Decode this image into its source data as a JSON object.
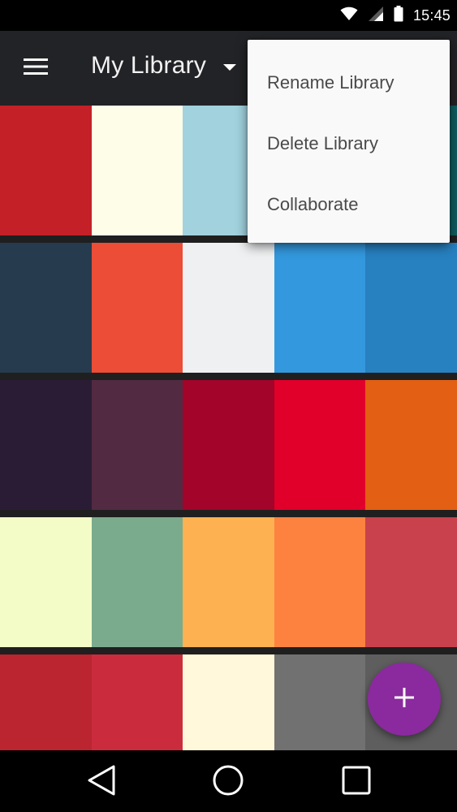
{
  "status_bar": {
    "time": "15:45",
    "icons": [
      "wifi-icon",
      "signal-icon",
      "battery-icon"
    ]
  },
  "app_bar": {
    "menu_icon": "hamburger-menu-icon",
    "title": "My Library",
    "dropdown_icon": "caret-down-icon"
  },
  "overflow_menu": {
    "items": [
      {
        "label": "Rename Library"
      },
      {
        "label": "Delete Library"
      },
      {
        "label": "Collaborate"
      }
    ]
  },
  "palettes": [
    {
      "colors": [
        "#c32127",
        "#fefde8",
        "#a1d2de",
        "#2b6f7a",
        "#0f5e62"
      ]
    },
    {
      "colors": [
        "#263b4d",
        "#eb4d37",
        "#eef0f1",
        "#3398dd",
        "#2780c0"
      ]
    },
    {
      "colors": [
        "#2a1c35",
        "#522a42",
        "#a2042a",
        "#e0002a",
        "#e25f13"
      ]
    },
    {
      "colors": [
        "#f3fbc7",
        "#7aab8d",
        "#fdb150",
        "#fd8240",
        "#c8414c"
      ]
    },
    {
      "colors": [
        "#ba2530",
        "#cb2c3d",
        "#fff8da",
        "#727171",
        "#5f5e5e"
      ]
    }
  ],
  "fab": {
    "icon": "plus-icon",
    "accent": "#8a2a9e"
  },
  "nav_bar": {
    "icons": [
      "back-icon",
      "home-icon",
      "recents-icon"
    ]
  }
}
